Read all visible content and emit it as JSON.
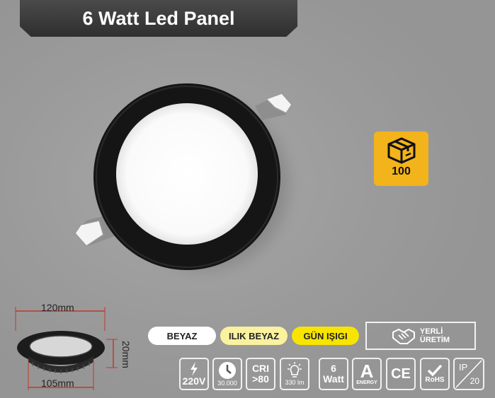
{
  "title": "6 Watt Led Panel",
  "box": {
    "icon": "box-icon",
    "count": "100"
  },
  "dimensions": {
    "diameter": "120mm",
    "cutout": "105mm",
    "height": "20mm"
  },
  "colors": [
    {
      "label": "BEYAZ",
      "bg": "#ffffff"
    },
    {
      "label": "ILIK BEYAZ",
      "bg": "#fbf2a0"
    },
    {
      "label": "GÜN IŞIGI",
      "bg": "#f7e400"
    }
  ],
  "yerli": {
    "line1": "YERLİ",
    "line2": "ÜRETİM",
    "icon": "handshake-icon"
  },
  "certs": {
    "voltage": {
      "icon": "lightning-icon",
      "label": "220V"
    },
    "life": {
      "icon": "clock-icon",
      "label": "30.000"
    },
    "cri": {
      "line1": "CRI",
      "line2": ">80"
    },
    "lumen": {
      "icon": "bulb-icon",
      "label": "330 lm"
    },
    "watt": {
      "line1": "6",
      "line2": "Watt"
    },
    "energy": {
      "letter": "A",
      "label": "ENERGY"
    },
    "ce": {
      "label": "CE"
    },
    "rohs": {
      "icon": "check-icon",
      "label": "RoHS"
    },
    "ip": {
      "line1": "IP",
      "line2": "20"
    }
  }
}
